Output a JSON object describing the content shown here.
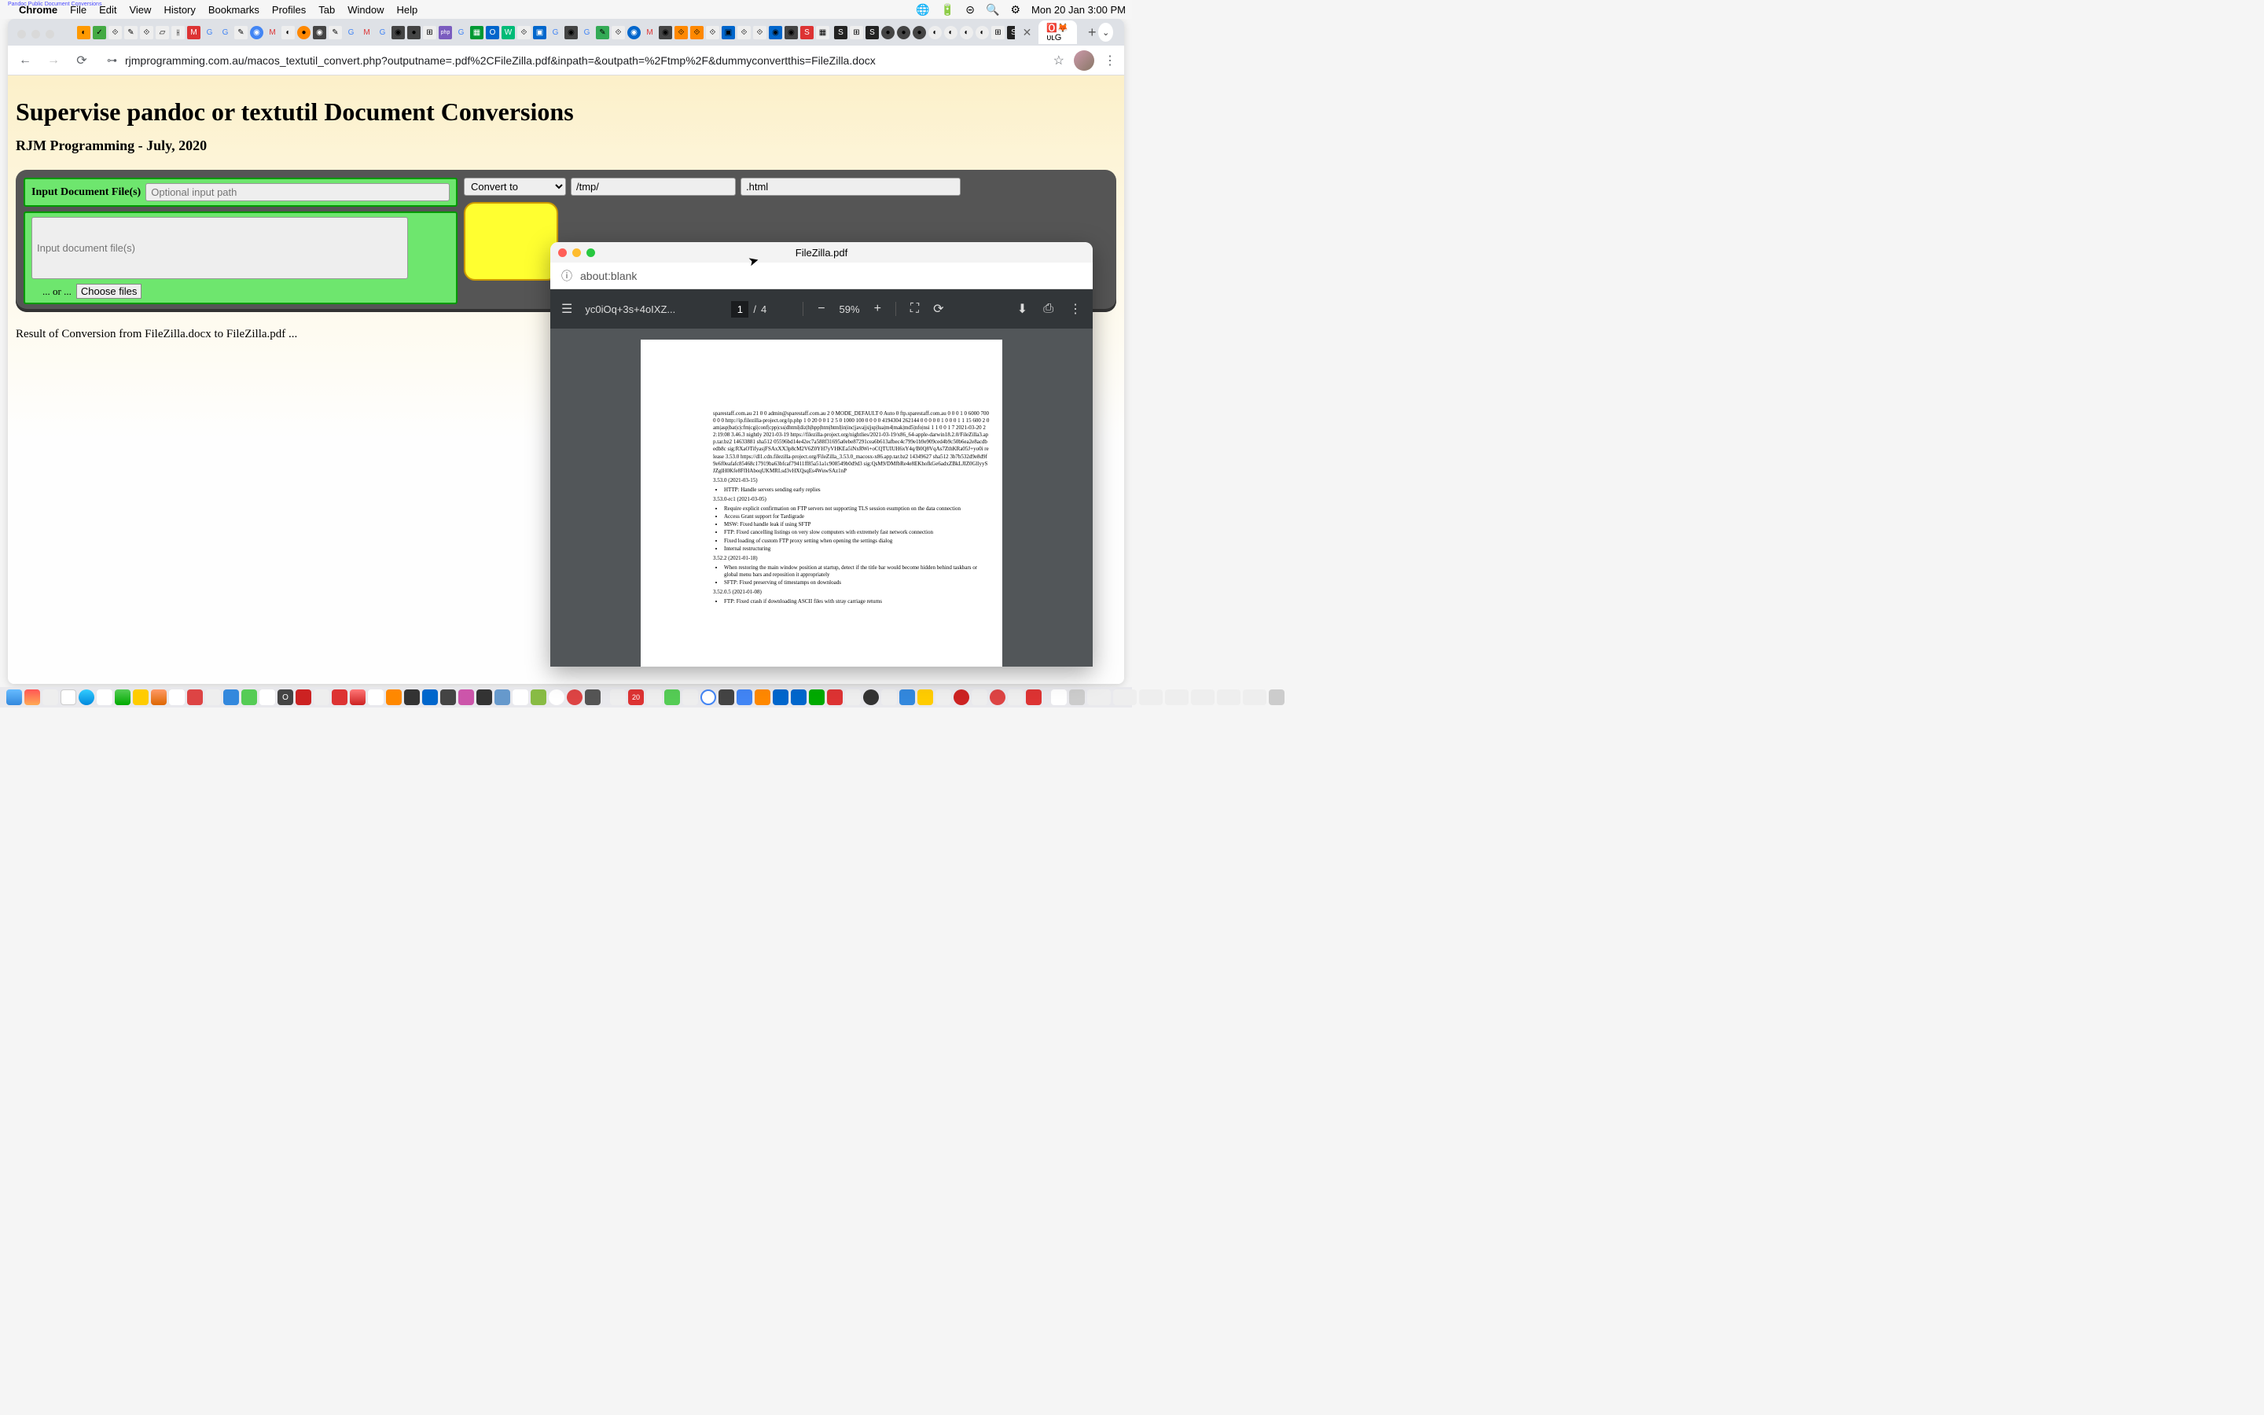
{
  "menubar": {
    "app": "Chrome",
    "items": [
      "File",
      "Edit",
      "View",
      "History",
      "Bookmarks",
      "Profiles",
      "Tab",
      "Window",
      "Help"
    ],
    "clock": "Mon 20 Jan  3:00 PM",
    "tiny_label": "Pandoc Public Document Conversions"
  },
  "browser": {
    "url": "rjmprogramming.com.au/macos_textutil_convert.php?outputname=.pdf%2CFileZilla.pdf&inpath=&outpath=%2Ftmp%2F&dummyconvertthis=FileZilla.docx",
    "active_tab_favicons": "🅾️🦊ᴜʟG"
  },
  "page": {
    "h1": "Supervise pandoc or textutil Document Conversions",
    "h3": "RJM Programming - July, 2020",
    "input_label": "Input Document File(s)",
    "optional_path_placeholder": "Optional input path",
    "input_files_placeholder": "Input document file(s)",
    "or_text": "... or ...",
    "choose_files": "Choose files",
    "convert_to": "Convert to",
    "dest_path": "/tmp/",
    "ext": ".html",
    "result": "Result of Conversion from FileZilla.docx to FileZilla.pdf ..."
  },
  "pdf_window": {
    "title": "FileZilla.pdf",
    "url": "about:blank",
    "filename": "yc0iOq+3s+4oIXZ...",
    "current_page": "1",
    "total_pages": "4",
    "zoom": "59%",
    "content": {
      "line1": "sparestaff.com.au 21 0 0 admin@sparestaff.com.au 2 0 MODE_DEFAULT 0 Auto 0 ftp.sparestaff.com.au 0 0 0 1 0 6000 7000 0 0 http://ip.filezilla-project.org/ip.php 1 0 20 0 0 1 2 5 0 1000 100 0 0 0 0 4194304 262144 0 0 0 0 0 1 0 0 0 1 1 15 600 2 0 am|asp|bat|c|cfm|cgi|conf|cpp|css|dhtml|diz|h|hpp|htm|html|in|inc|java|js|jsp|lua|m4|mak|md5|nfo|nsi 1 1 0 0 1 7 2021-03-20 22:19:08 3.46.3 nightly 2021-03-19 https://filezilla-project.org/nightlies/2021-03-19/x86_64-apple-darwin18.2.0/FileZilla3.app.tar.bz2 14633881 sha512 05596bd14e42ec7a588f31695a0ebe87291cea6b613afbec4c799e1b9e909ced4b9c50b6ea2e8acdbedb8c sig:RXaOTifyasjFSAxXX3p8cM2V6Z0YH7yVHKEa5iNxRWi+oCQTUIUH6xY4q/B0Q8VqAs7ZthKRa05J+yo0i release 3.53.0 https://dl1.cdn.filezilla-project.org/FileZilla_3.53.0_macosx-x86.app.tar.bz2 14349627 sha512 3b7b532d9e8d9f9e6f0eafafc85468c17919ba63bfcaf79411ff85a51a1c908549b0d9d3 sig:QsM9/DMfbRe4e8EKhofkGe6adxZBkLJIZ0GllyySJZglH0Kfe8FfHAboqUKMRLsd3vHXQsqEs4WuwSAz1nP",
      "sec1_head": "3.53.0 (2021-03-15)",
      "sec1_items": [
        "HTTP: Handle servers sending early replies"
      ],
      "sec2_head": "3.53.0-rc1 (2021-03-05)",
      "sec2_items": [
        "Require explicit confirmation on FTP servers not supporting TLS session esumption on the data connection",
        "Access Grant support for Tardigrade",
        "MSW: Fixed handle leak if using SFTP",
        "FTP: Fixed cancelling listings on very slow computers with extremely fast network connection",
        "Fixed loading of custom FTP proxy setting when opening the settings dialog",
        "Internal restructuring"
      ],
      "sec3_head": "3.52.2 (2021-01-18)",
      "sec3_items": [
        "When restoring the main window position at startup, detect if the title bar would become hidden behind taskbars or global menu bars and reposition it appropriately",
        "SFTP: Fixed preserving of timestamps on downloads"
      ],
      "sec4_head": "3.52.0.5 (2021-01-08)",
      "sec4_items": [
        "FTP: Fixed crash if downloading ASCII files with stray carriage returns"
      ]
    }
  }
}
